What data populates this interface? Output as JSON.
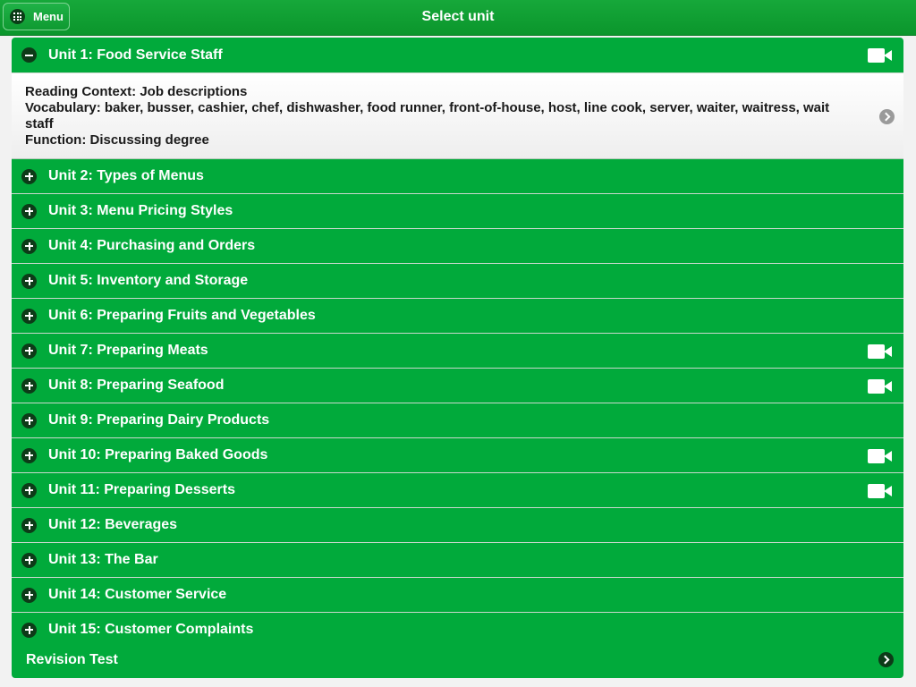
{
  "header": {
    "menu_label": "Menu",
    "title": "Select unit"
  },
  "expanded_detail": {
    "reading_context": "Reading Context: Job descriptions",
    "vocabulary": "Vocabulary: baker, busser, cashier, chef, dishwasher, food runner, front-of-house, host, line cook, server, waiter, waitress, wait staff",
    "function": "Function: Discussing degree"
  },
  "units": [
    {
      "label": "Unit 1: Food Service Staff",
      "expanded": true,
      "video": true,
      "icon": "minus-circle-icon"
    },
    {
      "label": "Unit 2: Types of Menus",
      "expanded": false,
      "video": false,
      "icon": "plus-circle-icon"
    },
    {
      "label": "Unit 3: Menu Pricing Styles",
      "expanded": false,
      "video": false,
      "icon": "plus-circle-icon"
    },
    {
      "label": "Unit 4: Purchasing and Orders",
      "expanded": false,
      "video": false,
      "icon": "plus-circle-icon"
    },
    {
      "label": "Unit 5: Inventory and Storage",
      "expanded": false,
      "video": false,
      "icon": "plus-circle-icon"
    },
    {
      "label": "Unit 6: Preparing Fruits and Vegetables",
      "expanded": false,
      "video": false,
      "icon": "plus-circle-icon"
    },
    {
      "label": "Unit 7: Preparing Meats",
      "expanded": false,
      "video": true,
      "icon": "plus-circle-icon"
    },
    {
      "label": "Unit 8: Preparing Seafood",
      "expanded": false,
      "video": true,
      "icon": "plus-circle-icon"
    },
    {
      "label": "Unit 9: Preparing Dairy Products",
      "expanded": false,
      "video": false,
      "icon": "plus-circle-icon"
    },
    {
      "label": "Unit 10: Preparing Baked Goods",
      "expanded": false,
      "video": true,
      "icon": "plus-circle-icon"
    },
    {
      "label": "Unit 11: Preparing Desserts",
      "expanded": false,
      "video": true,
      "icon": "plus-circle-icon"
    },
    {
      "label": "Unit 12: Beverages",
      "expanded": false,
      "video": false,
      "icon": "plus-circle-icon"
    },
    {
      "label": "Unit 13: The Bar",
      "expanded": false,
      "video": false,
      "icon": "plus-circle-icon"
    },
    {
      "label": "Unit 14: Customer Service",
      "expanded": false,
      "video": false,
      "icon": "plus-circle-icon"
    },
    {
      "label": "Unit 15: Customer Complaints",
      "expanded": false,
      "video": false,
      "icon": "plus-circle-icon"
    }
  ],
  "revision": {
    "label": "Revision Test"
  },
  "colors": {
    "row_green": "#01aa3b",
    "header_green": "#0f9e31",
    "icon_dark": "#0d3b18",
    "detail_text": "#1a1a1a"
  }
}
